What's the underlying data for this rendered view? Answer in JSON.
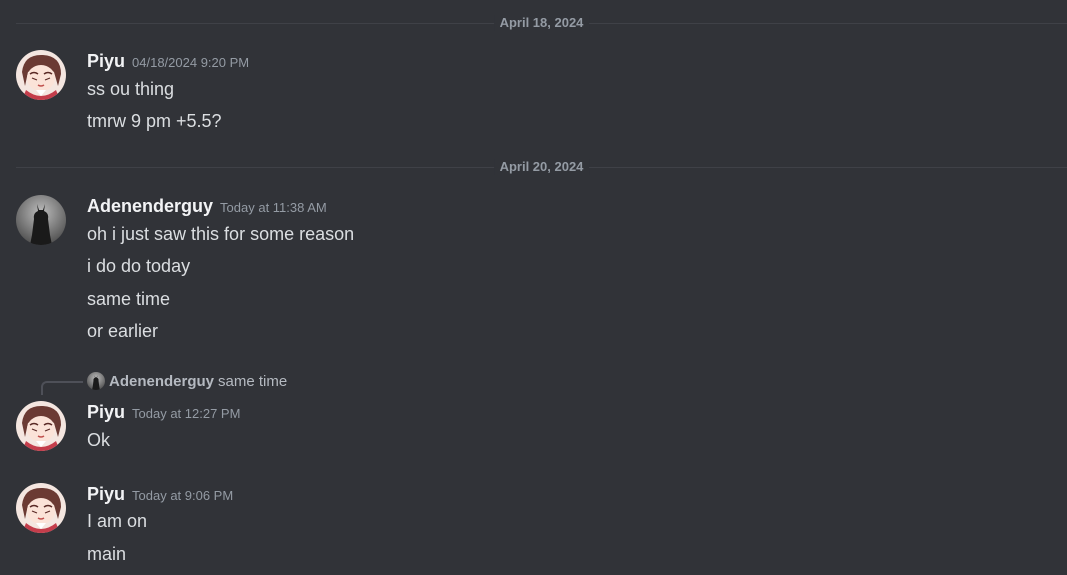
{
  "dividers": [
    "April 18, 2024",
    "April 20, 2024"
  ],
  "messages": [
    {
      "author": "Piyu",
      "timestamp": "04/18/2024 9:20 PM",
      "lines": [
        "ss ou thing",
        "tmrw 9 pm +5.5?"
      ]
    },
    {
      "author": "Adenenderguy",
      "timestamp": "Today at 11:38 AM",
      "lines": [
        "oh i just saw this for some reason",
        "i do do today",
        "same time",
        "or earlier"
      ]
    },
    {
      "reply": {
        "author": "Adenenderguy",
        "text": "same time"
      },
      "author": "Piyu",
      "timestamp": "Today at 12:27 PM",
      "lines": [
        "Ok"
      ]
    },
    {
      "author": "Piyu",
      "timestamp": "Today at 9:06 PM",
      "lines": [
        "I am on",
        "main"
      ]
    }
  ],
  "colors": {
    "background": "#313338",
    "author": "#f2f3f5",
    "message_text": "#dbdee1",
    "muted": "#949ba4"
  },
  "icons": {
    "piyu_avatar": "anime-avatar",
    "adenenderguy_avatar": "silhouette-avatar"
  }
}
